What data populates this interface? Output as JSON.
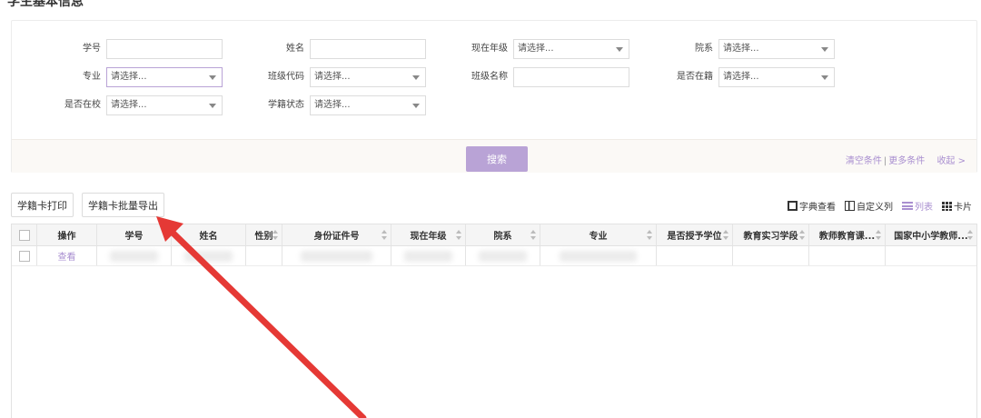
{
  "page": {
    "title": "学生基本信息"
  },
  "filters": {
    "row1": {
      "student_id_label": "学号",
      "student_id_value": "",
      "name_label": "姓名",
      "name_value": "",
      "grade_label": "现在年级",
      "grade_value": "请选择...",
      "department_label": "院系",
      "department_value": "请选择..."
    },
    "row2": {
      "major_label": "专业",
      "major_value": "请选择...",
      "class_code_label": "班级代码",
      "class_code_value": "请选择...",
      "class_name_label": "班级名称",
      "class_name_value": "",
      "enrolled_label": "是否在籍",
      "enrolled_value": "请选择..."
    },
    "row3": {
      "at_school_label": "是否在校",
      "at_school_value": "请选择...",
      "status_label": "学籍状态",
      "status_value": "请选择..."
    },
    "search_label": "搜索",
    "clear_label": "清空条件",
    "separator": "|",
    "more_label": "更多条件",
    "collapse_label": "收起 >"
  },
  "toolbar": {
    "print_label": "学籍卡打印",
    "export_label": "学籍卡批量导出",
    "dict_label": "字典查看",
    "custom_cols_label": "自定义列",
    "list_label": "列表",
    "card_label": "卡片"
  },
  "table": {
    "headers": [
      "操作",
      "学号",
      "姓名",
      "性别",
      "身份证件号",
      "现在年级",
      "院系",
      "专业",
      "是否授予学位",
      "教育实习学段",
      "教师教育课...",
      "国家中小学教师..."
    ],
    "row_action": "查看"
  },
  "colors": {
    "accent": "#b9a3d6",
    "link": "#a98fd0",
    "arrow": "#e53935"
  }
}
